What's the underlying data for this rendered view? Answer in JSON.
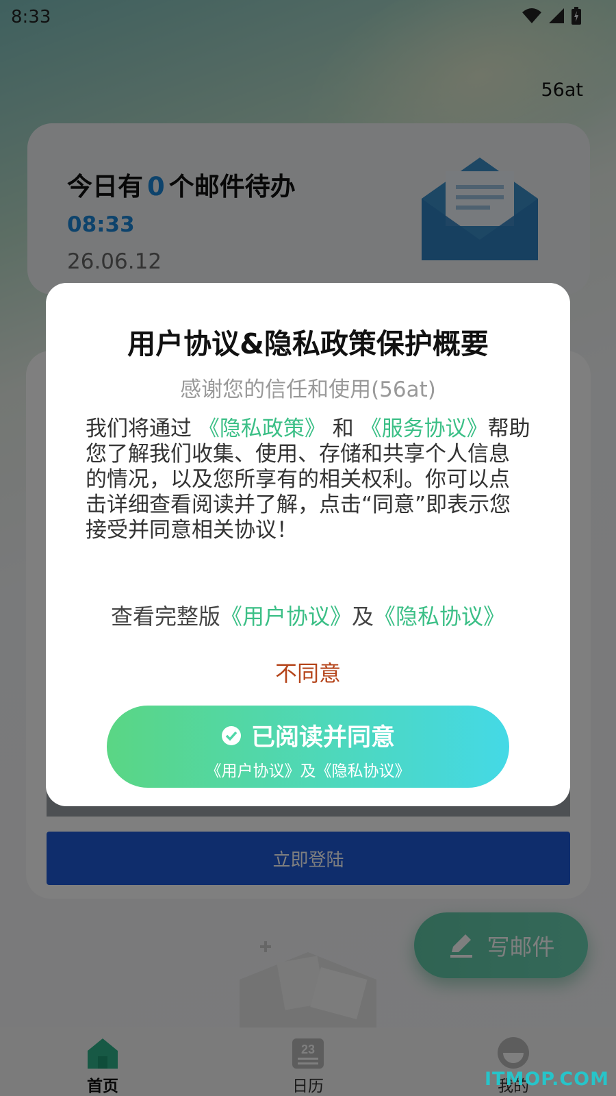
{
  "status_bar": {
    "time": "8:33"
  },
  "header": {
    "username": "56at",
    "todo_prefix": "今日有",
    "todo_count": "0",
    "todo_suffix": "个邮件待办",
    "time": "08:33",
    "date": "26.06.12"
  },
  "login": {
    "button_label": "立即登陆"
  },
  "fab": {
    "label": "写邮件",
    "icon": "pencil-icon"
  },
  "nav": {
    "items": [
      {
        "label": "首页",
        "icon": "home-icon"
      },
      {
        "label": "日历",
        "icon": "calendar-icon",
        "badge": "23"
      },
      {
        "label": "我的",
        "icon": "profile-icon"
      }
    ]
  },
  "dialog": {
    "title": "用户协议&隐私政策保护概要",
    "subtitle": "感谢您的信任和使用(56at)",
    "body_prefix": "我们将通过 ",
    "link_privacy_policy": "《隐私政策》",
    "body_and": " 和 ",
    "link_service_agreement": "《服务协议》",
    "body_rest": "帮助您了解我们收集、使用、存储和共享个人信息的情况，以及您所享有的相关权利。你可以点击详细查看阅读并了解，点击“同意”即表示您接受并同意相关协议！",
    "full_prefix": "查看完整版",
    "link_user_agreement": "《用户协议》",
    "full_and": "及",
    "link_privacy_agreement": "《隐私协议》",
    "disagree_label": "不同意",
    "agree_label": "已阅读并同意",
    "agree_sub": "《用户协议》及《隐私协议》"
  },
  "watermark": "ITMOP.COM",
  "colors": {
    "accent_blue": "#1a86d8",
    "link_green": "#3bbf86",
    "disagree": "#b5451b",
    "login_blue": "#1e5bd8"
  }
}
